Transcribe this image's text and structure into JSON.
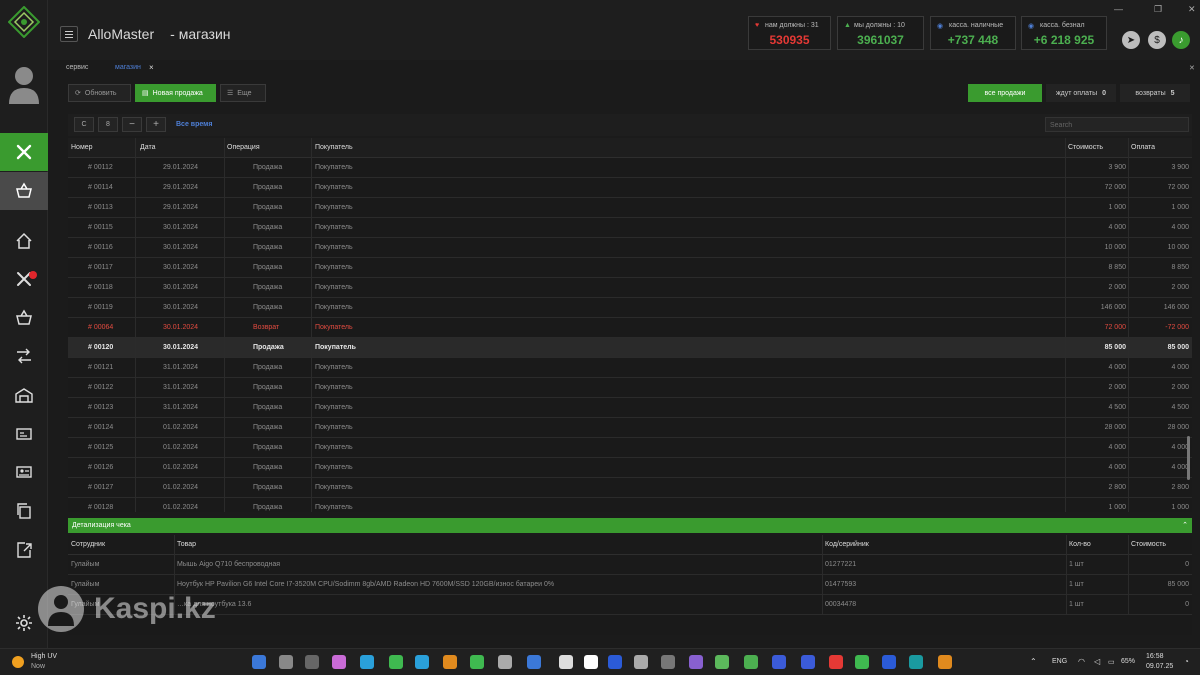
{
  "app": {
    "title": "AlloMaster",
    "subtitle": "-  магазин"
  },
  "stats": [
    {
      "label": "нам должны :  31",
      "value": "530935",
      "color": "#e53935",
      "icon": "heart-icon"
    },
    {
      "label": "мы должны :  10",
      "value": "3961037",
      "color": "#4caf50",
      "icon": "triangle-icon"
    },
    {
      "label": "касса. наличные",
      "value": "+737 448",
      "color": "#4caf50",
      "icon": "cash-icon"
    },
    {
      "label": "касса. безнал",
      "value": "+6 218 925",
      "color": "#4caf50",
      "icon": "card-icon"
    }
  ],
  "tabs": [
    {
      "label": "сервис",
      "active": false
    },
    {
      "label": "магазин",
      "active": true,
      "close": "×"
    }
  ],
  "toolbar": {
    "refresh": "Обновить",
    "new_sale": "Новая продажа",
    "more": "Еще"
  },
  "filters": [
    {
      "label": "все продажи",
      "count": ""
    },
    {
      "label": "ждут оплаты",
      "count": "0"
    },
    {
      "label": "возвраты",
      "count": "5"
    }
  ],
  "filterbar": {
    "c": "С",
    "num": "8",
    "minus": "−",
    "plus": "+",
    "all_time": "Все время",
    "search_placeholder": "Search"
  },
  "columns": {
    "number": "Номер",
    "date": "Дата",
    "operation": "Операция",
    "buyer": "Покупатель",
    "cost": "Стоимость",
    "payment": "Оплата"
  },
  "rows": [
    {
      "number": "# 00112",
      "date": "29.01.2024",
      "operation": "Продажа",
      "buyer": "Покупатель",
      "cost": "3 900",
      "payment": "3 900",
      "type": "normal"
    },
    {
      "number": "# 00114",
      "date": "29.01.2024",
      "operation": "Продажа",
      "buyer": "Покупатель",
      "cost": "72 000",
      "payment": "72 000",
      "type": "normal"
    },
    {
      "number": "# 00113",
      "date": "29.01.2024",
      "operation": "Продажа",
      "buyer": "Покупатель",
      "cost": "1 000",
      "payment": "1 000",
      "type": "normal"
    },
    {
      "number": "# 00115",
      "date": "30.01.2024",
      "operation": "Продажа",
      "buyer": "Покупатель",
      "cost": "4 000",
      "payment": "4 000",
      "type": "normal"
    },
    {
      "number": "# 00116",
      "date": "30.01.2024",
      "operation": "Продажа",
      "buyer": "Покупатель",
      "cost": "10 000",
      "payment": "10 000",
      "type": "normal"
    },
    {
      "number": "# 00117",
      "date": "30.01.2024",
      "operation": "Продажа",
      "buyer": "Покупатель",
      "cost": "8 850",
      "payment": "8 850",
      "type": "normal"
    },
    {
      "number": "# 00118",
      "date": "30.01.2024",
      "operation": "Продажа",
      "buyer": "Покупатель",
      "cost": "2 000",
      "payment": "2 000",
      "type": "normal"
    },
    {
      "number": "# 00119",
      "date": "30.01.2024",
      "operation": "Продажа",
      "buyer": "Покупатель",
      "cost": "146 000",
      "payment": "146 000",
      "type": "normal"
    },
    {
      "number": "# 00064",
      "date": "30.01.2024",
      "operation": "Возврат",
      "buyer": "Покупатель",
      "cost": "72 000",
      "payment": "-72 000",
      "type": "return"
    },
    {
      "number": "# 00120",
      "date": "30.01.2024",
      "operation": "Продажа",
      "buyer": "Покупатель",
      "cost": "85 000",
      "payment": "85 000",
      "type": "selected"
    },
    {
      "number": "# 00121",
      "date": "31.01.2024",
      "operation": "Продажа",
      "buyer": "Покупатель",
      "cost": "4 000",
      "payment": "4 000",
      "type": "normal"
    },
    {
      "number": "# 00122",
      "date": "31.01.2024",
      "operation": "Продажа",
      "buyer": "Покупатель",
      "cost": "2 000",
      "payment": "2 000",
      "type": "normal"
    },
    {
      "number": "# 00123",
      "date": "31.01.2024",
      "operation": "Продажа",
      "buyer": "Покупатель",
      "cost": "4 500",
      "payment": "4 500",
      "type": "normal"
    },
    {
      "number": "# 00124",
      "date": "01.02.2024",
      "operation": "Продажа",
      "buyer": "Покупатель",
      "cost": "28 000",
      "payment": "28 000",
      "type": "normal"
    },
    {
      "number": "# 00125",
      "date": "01.02.2024",
      "operation": "Продажа",
      "buyer": "Покупатель",
      "cost": "4 000",
      "payment": "4 000",
      "type": "normal"
    },
    {
      "number": "# 00126",
      "date": "01.02.2024",
      "operation": "Продажа",
      "buyer": "Покупатель",
      "cost": "4 000",
      "payment": "4 000",
      "type": "normal"
    },
    {
      "number": "# 00127",
      "date": "01.02.2024",
      "operation": "Продажа",
      "buyer": "Покупатель",
      "cost": "2 800",
      "payment": "2 800",
      "type": "normal"
    },
    {
      "number": "# 00128",
      "date": "01.02.2024",
      "operation": "Продажа",
      "buyer": "Покупатель",
      "cost": "1 000",
      "payment": "1 000",
      "type": "normal"
    }
  ],
  "detail": {
    "title": "Детализация чека",
    "columns": {
      "employee": "Сотрудник",
      "product": "Товар",
      "code": "Код/серийник",
      "qty": "Кол-во",
      "cost": "Стоимость"
    },
    "rows": [
      {
        "employee": "Гулайым",
        "product": "Мышь Aigo Q710 беспроводная",
        "code": "01277221",
        "qty": "1 шт",
        "cost": "0"
      },
      {
        "employee": "Гулайым",
        "product": "Ноутбук HP Pavilion G6 Intel Core I7-3520M CPU/Sodimm  8gb/AMD Radeon HD 7600M/SSD 120GB/износ батареи 0%",
        "code": "01477593",
        "qty": "1 шт",
        "cost": "85 000"
      },
      {
        "employee": "Гулайым",
        "product": "…ка для ноутбука 13.6",
        "code": "00034478",
        "qty": "1 шт",
        "cost": "0"
      }
    ]
  },
  "watermark": "Kaspi.kz",
  "taskbar": {
    "weather_title": "High UV",
    "weather_sub": "Now",
    "lang": "ENG",
    "battery": "65%",
    "time": "16:58",
    "date": "09.07.25"
  },
  "colors": {
    "accent": "#3a9b2f",
    "danger": "#e24b40"
  }
}
